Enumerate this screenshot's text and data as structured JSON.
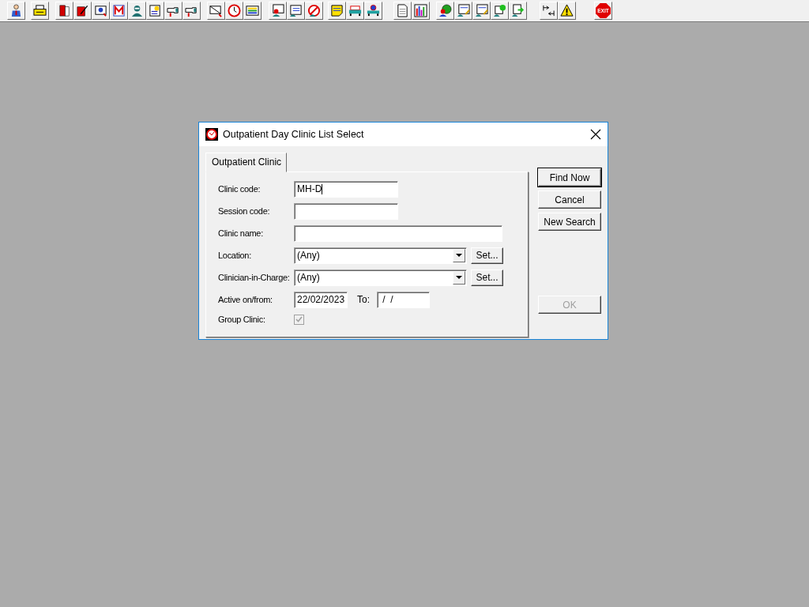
{
  "toolbar": {
    "exit_label": "EXIT"
  },
  "dialog": {
    "title": "Outpatient Day Clinic List Select",
    "tabs": [
      {
        "label": "Outpatient Clinic",
        "selected": true
      }
    ],
    "fields": [
      {
        "kind": "short_text",
        "label": "Clinic code:",
        "value": "MH-D"
      },
      {
        "kind": "short_text",
        "label": "Session code:"
      },
      {
        "kind": "long_text",
        "label": "Clinic name:"
      },
      {
        "kind": "select",
        "label": "Location:",
        "value": "(Any)",
        "button": "Set..."
      },
      {
        "kind": "select",
        "label": "Clinician-in-Charge:",
        "value": "(Any)",
        "button": "Set..."
      },
      {
        "kind": "daterange",
        "label": "Active on/from:",
        "value": "22/02/2023",
        "to_label": "To:",
        "to_value": " /  /"
      },
      {
        "kind": "checkbox",
        "label": "Group Clinic:",
        "checked": true,
        "disabled": true
      }
    ],
    "buttons": [
      {
        "label": "Find Now",
        "default": true,
        "disabled": false
      },
      {
        "label": "Cancel",
        "default": false,
        "disabled": false
      },
      {
        "label": "New Search",
        "default": false,
        "disabled": false
      },
      {
        "label": "OK",
        "default": false,
        "disabled": true
      }
    ]
  }
}
